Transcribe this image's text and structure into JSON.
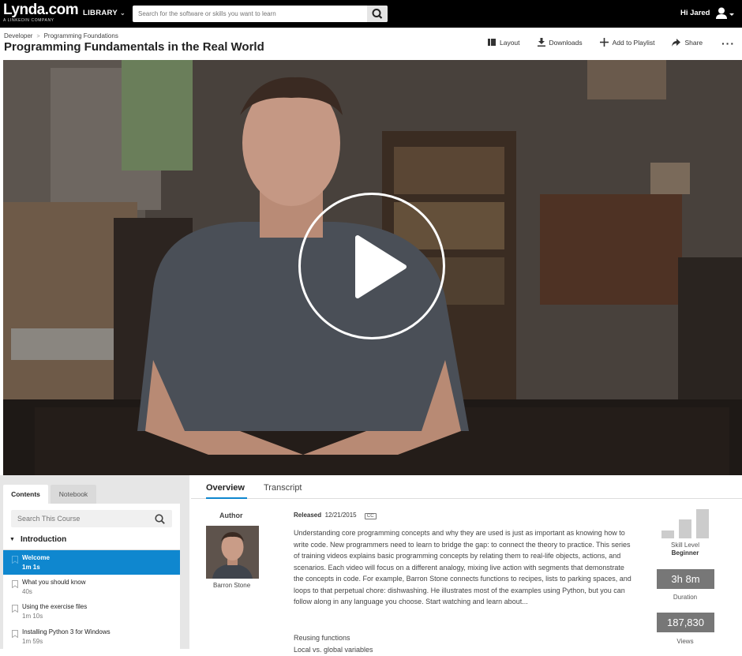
{
  "topbar": {
    "logo_main": "Lynda.com",
    "logo_sub": "A LINKEDIN COMPANY",
    "library": "LIBRARY",
    "search_placeholder": "Search for the software or skills you want to learn",
    "greeting": "Hi Jared"
  },
  "header": {
    "breadcrumbs": [
      "Developer",
      "Programming Foundations"
    ],
    "title": "Programming Fundamentals in the Real World",
    "actions": {
      "layout": "Layout",
      "downloads": "Downloads",
      "playlist": "Add to Playlist",
      "share": "Share"
    }
  },
  "sidebar": {
    "tabs": [
      "Contents",
      "Notebook"
    ],
    "search_placeholder": "Search This Course",
    "chapter": "Introduction",
    "lessons": [
      {
        "title": "Welcome",
        "duration": "1m 1s"
      },
      {
        "title": "What you should know",
        "duration": "40s"
      },
      {
        "title": "Using the exercise files",
        "duration": "1m 10s"
      },
      {
        "title": "Installing Python 3 for Windows",
        "duration": "1m 59s"
      }
    ]
  },
  "main": {
    "tabs": [
      "Overview",
      "Transcript"
    ],
    "author_heading": "Author",
    "author_name": "Barron Stone",
    "released_label": "Released",
    "released_date": "12/21/2015",
    "cc": "CC",
    "description": "Understanding core programming concepts and why they are used is just as important as knowing how to write code. New programmers need to learn to bridge the gap: to connect the theory to practice. This series of training videos explains basic programming concepts by relating them to real-life objects, actions, and scenarios. Each video will focus on a different analogy, mixing live action with segments that demonstrate the concepts in code. For example, Barron Stone connects functions to recipes, lists to parking spaces, and loops to that perpetual chore: dishwashing. He illustrates most of the examples using Python, but you can follow along in any language you choose. Start watching and learn about...",
    "topics": [
      "Reusing functions",
      "Local vs. global variables"
    ]
  },
  "stats": {
    "skill_label": "Skill Level",
    "skill_value": "Beginner",
    "duration": "3h 8m",
    "duration_label": "Duration",
    "views": "187,830",
    "views_label": "Views"
  },
  "colors": {
    "accent": "#0f87cf",
    "topbar": "#000000",
    "stat_box": "#777777"
  }
}
